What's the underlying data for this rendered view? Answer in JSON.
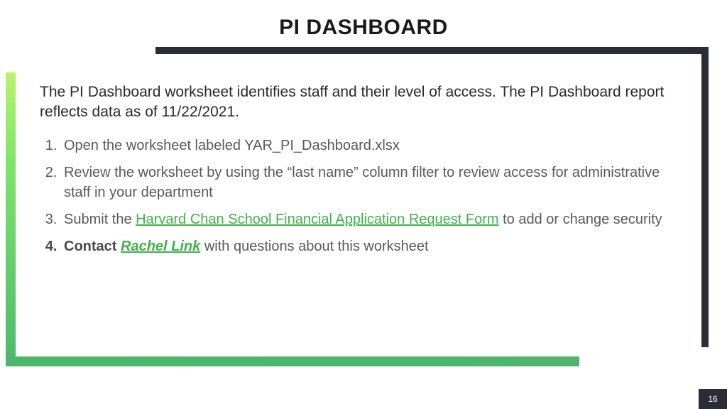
{
  "title": "PI DASHBOARD",
  "intro": "The PI Dashboard worksheet identifies staff and their level of access. The PI Dashboard report reflects data as of 11/22/2021.",
  "steps": {
    "s1": "Open the worksheet labeled YAR_PI_Dashboard.xlsx",
    "s2": "Review the worksheet by using the “last name” column filter to review access for administrative staff in your department",
    "s3_pre": "Submit the ",
    "s3_link": "Harvard Chan School Financial Application Request Form",
    "s3_post": " to add or change security",
    "s4_pre": "Contact ",
    "s4_link": "Rachel Link",
    "s4_post": " with questions about this worksheet"
  },
  "page_number": "16"
}
